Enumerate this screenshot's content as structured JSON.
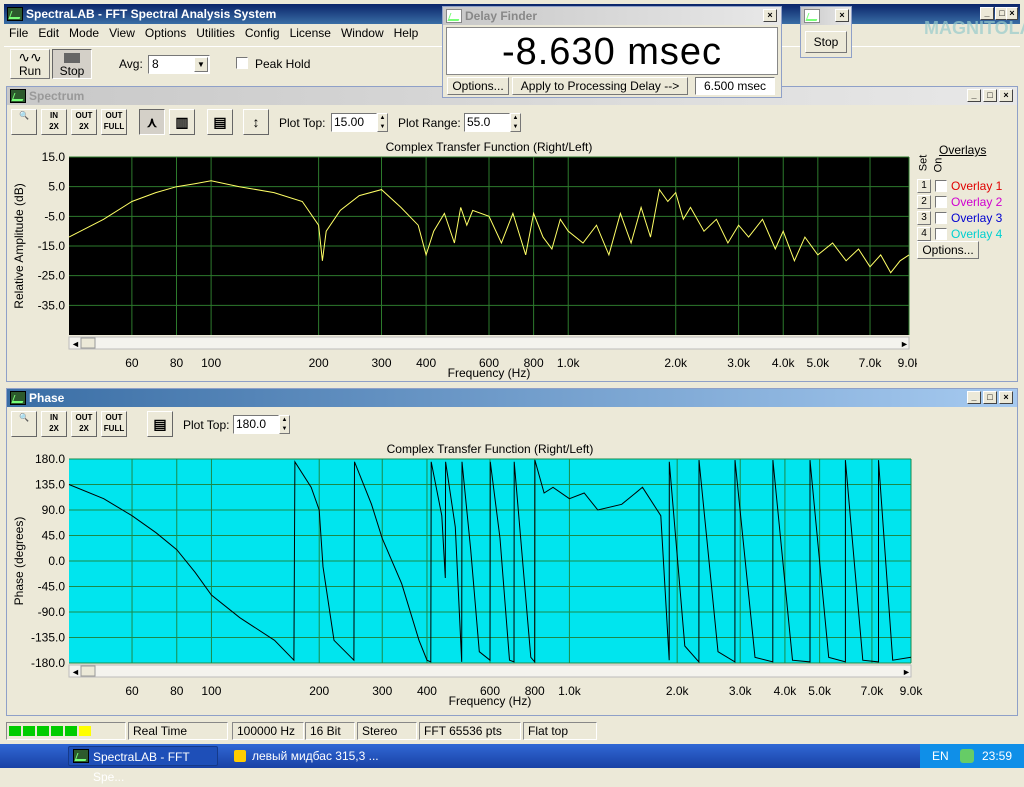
{
  "app": {
    "title": "SpectraLAB - FFT Spectral Analysis System"
  },
  "menu": [
    "File",
    "Edit",
    "Mode",
    "View",
    "Options",
    "Utilities",
    "Config",
    "License",
    "Window",
    "Help"
  ],
  "toolbar": {
    "run_label": "Run",
    "stop_label": "Stop",
    "avg_label": "Avg:",
    "avg_value": "8",
    "peak_hold_label": "Peak Hold"
  },
  "delay_finder": {
    "title": "Delay Finder",
    "value": "-8.630 msec",
    "options_label": "Options...",
    "apply_label": "Apply to Processing Delay -->",
    "delay_value": "6.500 msec"
  },
  "small_win": {
    "stop_label": "Stop"
  },
  "watermark": "MAGNITOLA",
  "spectrum": {
    "title": "Spectrum",
    "plot_top_label": "Plot Top:",
    "plot_top_value": "15.00",
    "plot_range_label": "Plot Range:",
    "plot_range_value": "55.0",
    "chart_title": "Complex Transfer Function (Right/Left)",
    "ylabel": "Relative Amplitude (dB)",
    "xlabel": "Frequency (Hz)",
    "overlays": {
      "title": "Overlays",
      "set_label": "Set",
      "on_label": "On",
      "options_label": "Options...",
      "items": [
        {
          "num": "1",
          "label": "Overlay 1",
          "color": "#e00000"
        },
        {
          "num": "2",
          "label": "Overlay 2",
          "color": "#d000d0"
        },
        {
          "num": "3",
          "label": "Overlay 3",
          "color": "#0000d0"
        },
        {
          "num": "4",
          "label": "Overlay 4",
          "color": "#00d0d0"
        }
      ]
    }
  },
  "phase": {
    "title": "Phase",
    "plot_top_label": "Plot Top:",
    "plot_top_value": "180.0",
    "chart_title": "Complex Transfer Function (Right/Left)",
    "ylabel": "Phase (degrees)",
    "xlabel": "Frequency (Hz)"
  },
  "chart_data": [
    {
      "type": "line",
      "title": "Complex Transfer Function (Right/Left)",
      "xlabel": "Frequency (Hz)",
      "ylabel": "Relative Amplitude (dB)",
      "xscale": "log",
      "xlim": [
        40,
        9000
      ],
      "ylim": [
        -45,
        15
      ],
      "xticks": [
        {
          "v": 60,
          "label": "60"
        },
        {
          "v": 80,
          "label": "80"
        },
        {
          "v": 100,
          "label": "100"
        },
        {
          "v": 200,
          "label": "200"
        },
        {
          "v": 300,
          "label": "300"
        },
        {
          "v": 400,
          "label": "400"
        },
        {
          "v": 600,
          "label": "600"
        },
        {
          "v": 800,
          "label": "800"
        },
        {
          "v": 1000,
          "label": "1.0k"
        },
        {
          "v": 2000,
          "label": "2.0k"
        },
        {
          "v": 3000,
          "label": "3.0k"
        },
        {
          "v": 4000,
          "label": "4.0k"
        },
        {
          "v": 5000,
          "label": "5.0k"
        },
        {
          "v": 7000,
          "label": "7.0k"
        },
        {
          "v": 9000,
          "label": "9.0k"
        }
      ],
      "yticks": [
        {
          "v": 15,
          "label": "15.0"
        },
        {
          "v": 5,
          "label": "5.0"
        },
        {
          "v": -5,
          "label": "-5.0"
        },
        {
          "v": -15,
          "label": "-15.0"
        },
        {
          "v": -25,
          "label": "-25.0"
        },
        {
          "v": -35,
          "label": "-35.0"
        }
      ],
      "grid": true,
      "background": "#000000",
      "line_color": "#ffff66",
      "x": [
        40,
        50,
        60,
        70,
        80,
        90,
        100,
        120,
        150,
        180,
        200,
        205,
        210,
        230,
        260,
        300,
        340,
        380,
        400,
        420,
        450,
        480,
        500,
        520,
        540,
        600,
        650,
        700,
        760,
        800,
        850,
        900,
        950,
        1000,
        1100,
        1200,
        1300,
        1400,
        1500,
        1600,
        1700,
        1800,
        1900,
        2000,
        2100,
        2200,
        2400,
        2600,
        2800,
        3000,
        3200,
        3500,
        3800,
        4000,
        4300,
        4600,
        5000,
        5500,
        6000,
        6500,
        7000,
        7500,
        8000,
        8500,
        9000
      ],
      "y": [
        -12,
        -6,
        0,
        3,
        5,
        6,
        7,
        5,
        3,
        0,
        -8,
        -20,
        -10,
        -3,
        2,
        4,
        -2,
        -8,
        -18,
        -10,
        -4,
        -14,
        -2,
        -8,
        -3,
        -5,
        -14,
        -4,
        -18,
        -4,
        -12,
        -16,
        -6,
        -10,
        -14,
        -8,
        -18,
        -4,
        -14,
        -2,
        -12,
        4,
        0,
        3,
        -6,
        -2,
        -10,
        -6,
        -14,
        -8,
        -12,
        -6,
        -16,
        -10,
        -20,
        -12,
        -18,
        -14,
        -20,
        -16,
        -22,
        -18,
        -24,
        -20,
        -18
      ]
    },
    {
      "type": "line",
      "title": "Complex Transfer Function (Right/Left)",
      "xlabel": "Frequency (Hz)",
      "ylabel": "Phase (degrees)",
      "xscale": "log",
      "xlim": [
        40,
        9000
      ],
      "ylim": [
        -180,
        180
      ],
      "xticks": [
        {
          "v": 60,
          "label": "60"
        },
        {
          "v": 80,
          "label": "80"
        },
        {
          "v": 100,
          "label": "100"
        },
        {
          "v": 200,
          "label": "200"
        },
        {
          "v": 300,
          "label": "300"
        },
        {
          "v": 400,
          "label": "400"
        },
        {
          "v": 600,
          "label": "600"
        },
        {
          "v": 800,
          "label": "800"
        },
        {
          "v": 1000,
          "label": "1.0k"
        },
        {
          "v": 2000,
          "label": "2.0k"
        },
        {
          "v": 3000,
          "label": "3.0k"
        },
        {
          "v": 4000,
          "label": "4.0k"
        },
        {
          "v": 5000,
          "label": "5.0k"
        },
        {
          "v": 7000,
          "label": "7.0k"
        },
        {
          "v": 9000,
          "label": "9.0k"
        }
      ],
      "yticks": [
        {
          "v": 180,
          "label": "180.0"
        },
        {
          "v": 135,
          "label": "135.0"
        },
        {
          "v": 90,
          "label": "90.0"
        },
        {
          "v": 45,
          "label": "45.0"
        },
        {
          "v": 0,
          "label": "0.0"
        },
        {
          "v": -45,
          "label": "-45.0"
        },
        {
          "v": -90,
          "label": "-90.0"
        },
        {
          "v": -135,
          "label": "-135.0"
        },
        {
          "v": -180,
          "label": "-180.0"
        }
      ],
      "grid": true,
      "background": "#00e5ee",
      "line_color": "#000000",
      "x": [
        40,
        50,
        60,
        70,
        80,
        90,
        100,
        120,
        150,
        170,
        171,
        190,
        200,
        205,
        220,
        250,
        251,
        280,
        300,
        340,
        380,
        400,
        410,
        411,
        440,
        450,
        451,
        480,
        500,
        501,
        530,
        560,
        600,
        601,
        640,
        680,
        700,
        701,
        740,
        780,
        800,
        801,
        850,
        900,
        1000,
        1100,
        1200,
        1400,
        1600,
        1800,
        1900,
        1901,
        2100,
        2300,
        2301,
        2600,
        2900,
        2901,
        3300,
        3700,
        3701,
        4200,
        4700,
        4701,
        5300,
        5900,
        5901,
        6600,
        7300,
        7301,
        8000,
        9000
      ],
      "y": [
        135,
        110,
        80,
        50,
        20,
        -20,
        -60,
        -100,
        -140,
        -175,
        175,
        130,
        90,
        -10,
        -140,
        -175,
        175,
        100,
        40,
        -40,
        -140,
        -175,
        -178,
        175,
        80,
        -30,
        175,
        60,
        -178,
        175,
        20,
        -160,
        -175,
        175,
        40,
        -175,
        -178,
        175,
        0,
        -170,
        -178,
        178,
        120,
        130,
        110,
        120,
        90,
        100,
        130,
        80,
        -175,
        175,
        -150,
        -178,
        178,
        -160,
        -178,
        178,
        -170,
        -178,
        178,
        -175,
        -178,
        178,
        -170,
        -178,
        178,
        -175,
        -178,
        178,
        -175,
        -170
      ]
    }
  ],
  "status": {
    "real_time": "Real Time",
    "rate": "100000 Hz",
    "bits": "16 Bit",
    "channels": "Stereo",
    "fft": "FFT 65536 pts",
    "window": "Flat top"
  },
  "taskbar": {
    "task1": "SpectraLAB - FFT Spe...",
    "task2": "левый мидбас 315,3 ...",
    "lang": "EN",
    "clock": "23:59"
  }
}
